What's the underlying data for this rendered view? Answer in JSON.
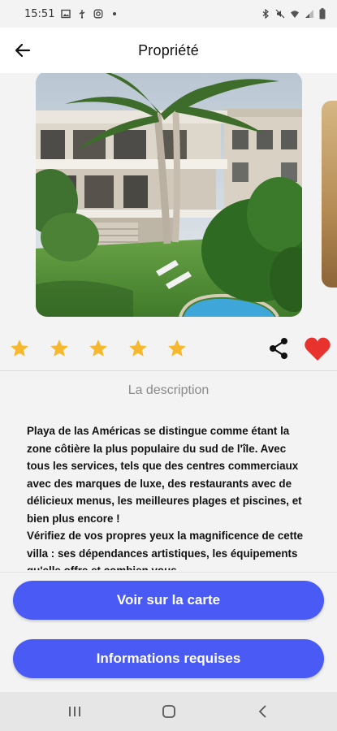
{
  "status_bar": {
    "time": "15:51",
    "left_icons": [
      "image-icon",
      "usb-icon",
      "instagram-icon",
      "dot-icon"
    ],
    "right_icons": [
      "bluetooth-icon",
      "mute-icon",
      "wifi-icon",
      "signal-icon",
      "battery-icon"
    ]
  },
  "app_bar": {
    "title": "Propriété",
    "back_icon": "arrow-left-icon"
  },
  "rating": {
    "value": 5,
    "max": 5,
    "star_color": "#f5b82e"
  },
  "actions": {
    "share_icon": "share-icon",
    "favorite_icon": "heart-icon",
    "favorite_active": true,
    "favorite_color": "#e8322e"
  },
  "description": {
    "title": "La description",
    "text": "Playa de las Américas se distingue comme étant la zone côtière la plus populaire du sud de l'île. Avec tous les services, tels que des centres commerciaux avec des marques de luxe, des restaurants avec de délicieux menus, les meilleures plages et piscines, et bien plus encore !\nVérifiez de vos propres yeux la magnificence de cette villa : ses dépendances artistiques, les équipements qu'elle offre et combien vous"
  },
  "buttons": {
    "map_label": "Voir sur la carte",
    "info_label": "Informations requises",
    "color": "#4a5af5"
  },
  "nav_bar": {
    "icons": [
      "recents-icon",
      "home-icon",
      "back-icon"
    ]
  }
}
